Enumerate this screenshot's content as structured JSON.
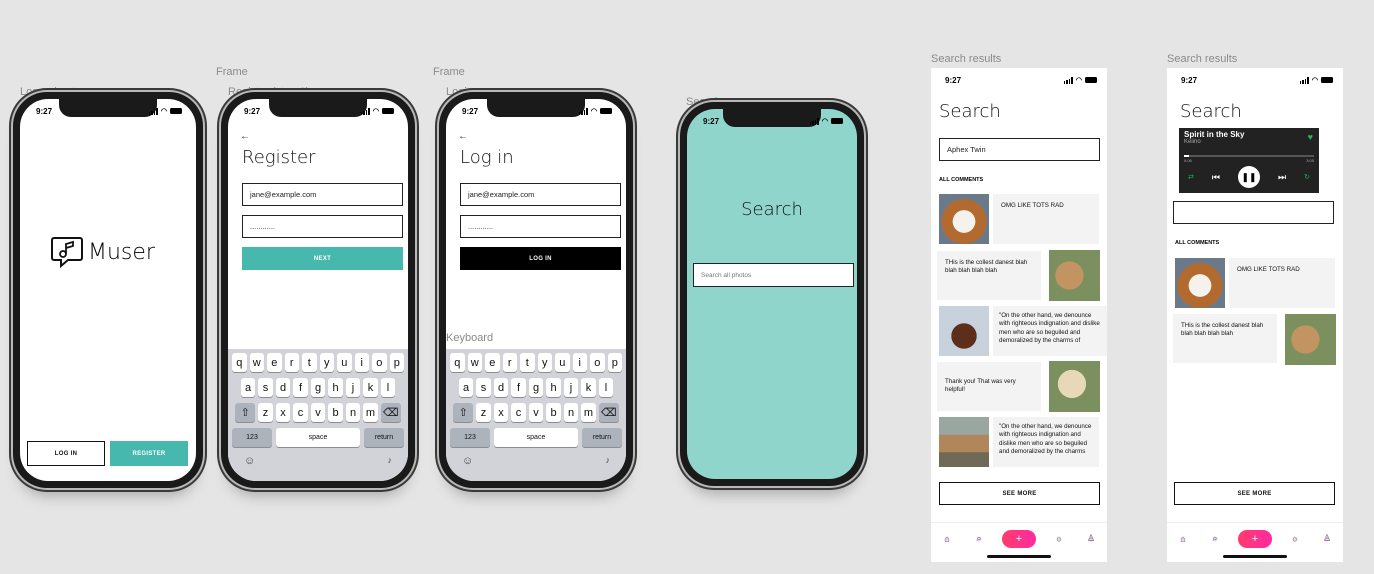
{
  "labels": {
    "logged_out": "Logged out",
    "frame1": "Frame",
    "register_step": "Register (step 1)",
    "frame2": "Frame",
    "login": "Login",
    "search": "Search",
    "keyboard": "Keyboard",
    "results1": "Search results",
    "results2": "Search results"
  },
  "status_time": "9:27",
  "splash": {
    "brand": "Muser",
    "login_btn": "LOG IN",
    "register_btn": "REGISTER",
    "accent": "#46b8ad"
  },
  "register": {
    "back": "←",
    "title": "Register",
    "email": "jane@example.com",
    "password": "............",
    "next_btn": "NEXT"
  },
  "login": {
    "back": "←",
    "title": "Log in",
    "email": "jane@example.com",
    "password": "............",
    "login_btn": "LOG IN"
  },
  "keyboard": {
    "row1": [
      "q",
      "w",
      "e",
      "r",
      "t",
      "y",
      "u",
      "i",
      "o",
      "p"
    ],
    "row2": [
      "a",
      "s",
      "d",
      "f",
      "g",
      "h",
      "j",
      "k",
      "l"
    ],
    "row3": [
      "z",
      "x",
      "c",
      "v",
      "b",
      "n",
      "m"
    ],
    "shift": "⇧",
    "delete": "⌫",
    "numbers": "123",
    "space": "space",
    "return": "return",
    "emoji": "☺",
    "mic": "🎙"
  },
  "search_screen": {
    "title": "Search",
    "placeholder": "Search all photos",
    "bg": "#8fd5cb"
  },
  "results1": {
    "title": "Search",
    "query": "Aphex  Twin",
    "section": "ALL COMMENTS",
    "comments": [
      "OMG LIKE TOTS  RAD",
      "THis is the collest danest blah blah blah blah blah",
      "\"On the other hand, we denounce with righteous indignation and dislike men who are so beguiled and demoralized by the charms of",
      "Thank you! That was very helpful!",
      "\"On the other hand, we denounce with righteous indignation and dislike men who are so beguiled and demoralized by the charms"
    ],
    "see_more": "SEE MORE"
  },
  "results2": {
    "title": "Search",
    "player": {
      "song": "Spirit in the Sky",
      "artist": "Keiino",
      "elapsed": "0:06",
      "total": "3:05"
    },
    "section": "ALL COMMENTS",
    "comments": [
      "OMG LIKE TOTS  RAD",
      "THis is the collest danest blah blah blah blah blah"
    ],
    "see_more": "SEE MORE"
  }
}
